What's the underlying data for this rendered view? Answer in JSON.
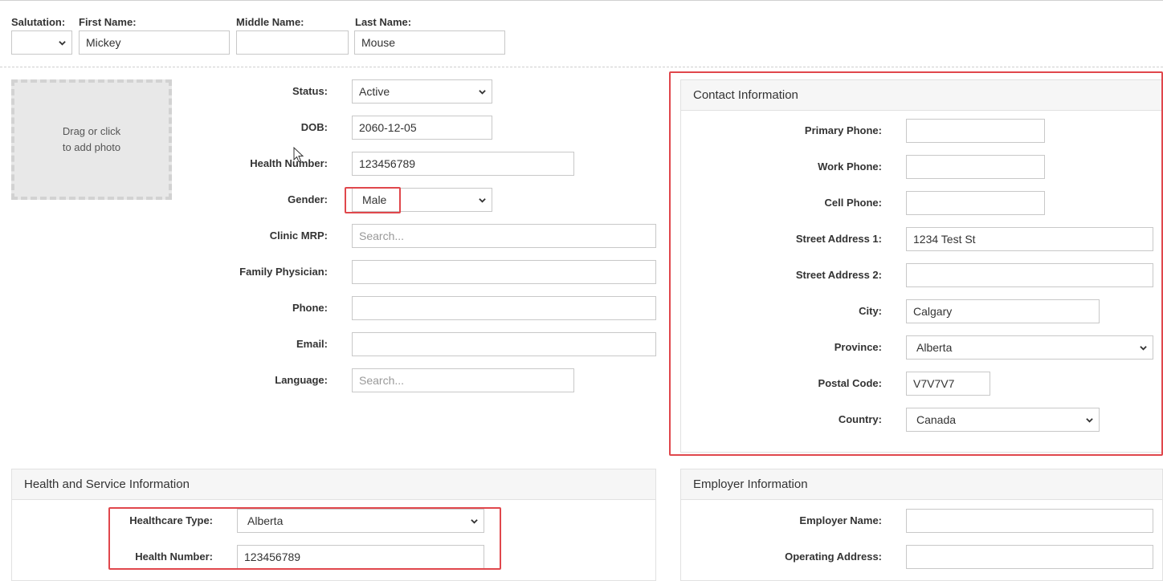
{
  "name_row": {
    "salutation": {
      "label": "Salutation:",
      "value": ""
    },
    "first_name": {
      "label": "First Name:",
      "value": "Mickey"
    },
    "middle_name": {
      "label": "Middle Name:",
      "value": ""
    },
    "last_name": {
      "label": "Last Name:",
      "value": "Mouse"
    }
  },
  "photo": {
    "line1": "Drag or click",
    "line2": "to add photo"
  },
  "demographics": {
    "status": {
      "label": "Status:",
      "value": "Active"
    },
    "dob": {
      "label": "DOB:",
      "value": "2060-12-05"
    },
    "health_number": {
      "label": "Health Number:",
      "value": "123456789"
    },
    "gender": {
      "label": "Gender:",
      "value": "Male"
    },
    "clinic_mrp": {
      "label": "Clinic MRP:",
      "placeholder": "Search..."
    },
    "family_physician": {
      "label": "Family Physician:",
      "value": ""
    },
    "phone": {
      "label": "Phone:",
      "value": ""
    },
    "email": {
      "label": "Email:",
      "value": ""
    },
    "language": {
      "label": "Language:",
      "placeholder": "Search..."
    }
  },
  "contact": {
    "title": "Contact Information",
    "primary_phone": {
      "label": "Primary Phone:",
      "value": ""
    },
    "work_phone": {
      "label": "Work Phone:",
      "value": ""
    },
    "cell_phone": {
      "label": "Cell Phone:",
      "value": ""
    },
    "street1": {
      "label": "Street Address 1:",
      "value": "1234 Test St"
    },
    "street2": {
      "label": "Street Address 2:",
      "value": ""
    },
    "city": {
      "label": "City:",
      "value": "Calgary"
    },
    "province": {
      "label": "Province:",
      "value": "Alberta"
    },
    "postal_code": {
      "label": "Postal Code:",
      "value": "V7V7V7"
    },
    "country": {
      "label": "Country:",
      "value": "Canada"
    }
  },
  "health_service": {
    "title": "Health and Service Information",
    "healthcare_type": {
      "label": "Healthcare Type:",
      "value": "Alberta"
    },
    "health_number": {
      "label": "Health Number:",
      "value": "123456789"
    }
  },
  "employer": {
    "title": "Employer Information",
    "employer_name": {
      "label": "Employer Name:",
      "value": ""
    },
    "operating_address": {
      "label": "Operating Address:",
      "value": ""
    }
  },
  "colors": {
    "highlight": "#e0474c",
    "panel_header": "#f6f6f6",
    "border": "#c8c8c8"
  },
  "icons": {
    "select_arrow": "chevron-down-icon",
    "cursor": "mouse-pointer-icon"
  }
}
